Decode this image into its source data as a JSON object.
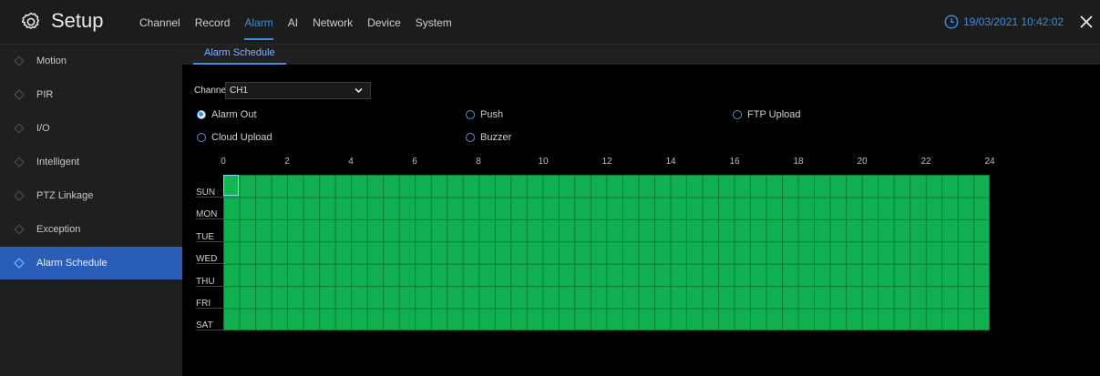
{
  "header": {
    "title": "Setup",
    "menu": [
      {
        "label": "Channel",
        "active": false
      },
      {
        "label": "Record",
        "active": false
      },
      {
        "label": "Alarm",
        "active": true
      },
      {
        "label": "AI",
        "active": false
      },
      {
        "label": "Network",
        "active": false
      },
      {
        "label": "Device",
        "active": false
      },
      {
        "label": "System",
        "active": false
      }
    ],
    "datetime": "19/03/2021 10:42:02",
    "icons": {
      "settings": "gear-icon",
      "clock": "clock-icon",
      "close": "close-icon"
    }
  },
  "sidebar": {
    "items": [
      {
        "label": "Motion"
      },
      {
        "label": "PIR"
      },
      {
        "label": "I/O"
      },
      {
        "label": "Intelligent"
      },
      {
        "label": "PTZ Linkage"
      },
      {
        "label": "Exception"
      },
      {
        "label": "Alarm Schedule",
        "active": true
      }
    ]
  },
  "tabs": [
    {
      "label": "Alarm Schedule",
      "active": true
    }
  ],
  "channel": {
    "label": "Channel",
    "value": "CH1"
  },
  "options": [
    {
      "label": "Alarm Out",
      "checked": true
    },
    {
      "label": "Push",
      "checked": false
    },
    {
      "label": "FTP Upload",
      "checked": false
    },
    {
      "label": "Cloud Upload",
      "checked": false
    },
    {
      "label": "Buzzer",
      "checked": false
    }
  ],
  "schedule": {
    "hour_labels": [
      "0",
      "2",
      "4",
      "6",
      "8",
      "10",
      "12",
      "14",
      "16",
      "18",
      "20",
      "22",
      "24"
    ],
    "days": [
      "SUN",
      "MON",
      "TUE",
      "WED",
      "THU",
      "FRI",
      "SAT"
    ],
    "active_color": "#10b050"
  },
  "colors": {
    "accent": "#3b8fe0",
    "sidebar_active": "#2a5db8"
  }
}
